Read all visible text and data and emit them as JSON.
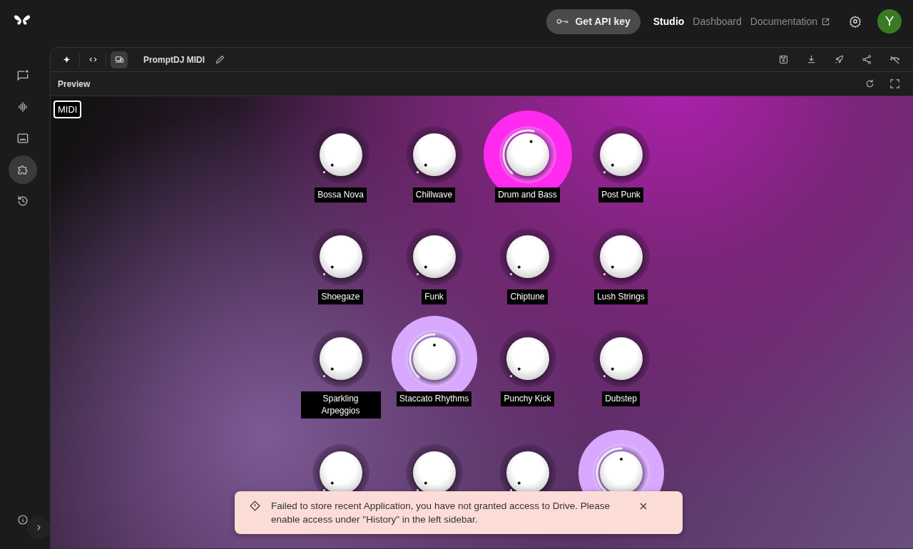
{
  "topbar": {
    "api_button": "Get API key",
    "nav": [
      {
        "label": "Studio",
        "selected": true,
        "external": false
      },
      {
        "label": "Dashboard",
        "selected": false,
        "external": false
      },
      {
        "label": "Documentation",
        "selected": false,
        "external": true
      }
    ],
    "avatar": "Y"
  },
  "sidebar": {
    "items": [
      {
        "kind": "chat",
        "selected": false
      },
      {
        "kind": "audio",
        "selected": false
      },
      {
        "kind": "image",
        "selected": false
      },
      {
        "kind": "apps",
        "selected": true
      },
      {
        "kind": "history",
        "selected": false
      }
    ]
  },
  "toolbar": {
    "modes": [
      {
        "kind": "sparkle",
        "selected": false
      },
      {
        "kind": "code",
        "selected": false
      },
      {
        "kind": "preview",
        "selected": true
      }
    ],
    "app_name": "PromptDJ MIDI"
  },
  "preview": {
    "title": "Preview",
    "badge": "MIDI",
    "knobs": [
      {
        "label": "Bossa Nova",
        "active": false
      },
      {
        "label": "Chillwave",
        "active": false
      },
      {
        "label": "Drum and Bass",
        "active": true,
        "level": 0.55,
        "color": "#ff2af0"
      },
      {
        "label": "Post Punk",
        "active": false
      },
      {
        "label": "Shoegaze",
        "active": false
      },
      {
        "label": "Funk",
        "active": false
      },
      {
        "label": "Chiptune",
        "active": false
      },
      {
        "label": "Lush Strings",
        "active": false
      },
      {
        "label": "Sparkling Arpeggios",
        "active": false
      },
      {
        "label": "Staccato Rhythms",
        "active": true,
        "level": 0.5,
        "color": "#d8a8ff"
      },
      {
        "label": "Punchy Kick",
        "active": false
      },
      {
        "label": "Dubstep",
        "active": false
      },
      {
        "active": false
      },
      {
        "active": false
      },
      {
        "active": false
      },
      {
        "active": true,
        "level": 0.5,
        "color": "#d8a8ff"
      }
    ]
  },
  "toast": {
    "message": "Failed to store recent Application, you have not granted access to Drive. Please enable access under \"History\" in the left sidebar."
  }
}
